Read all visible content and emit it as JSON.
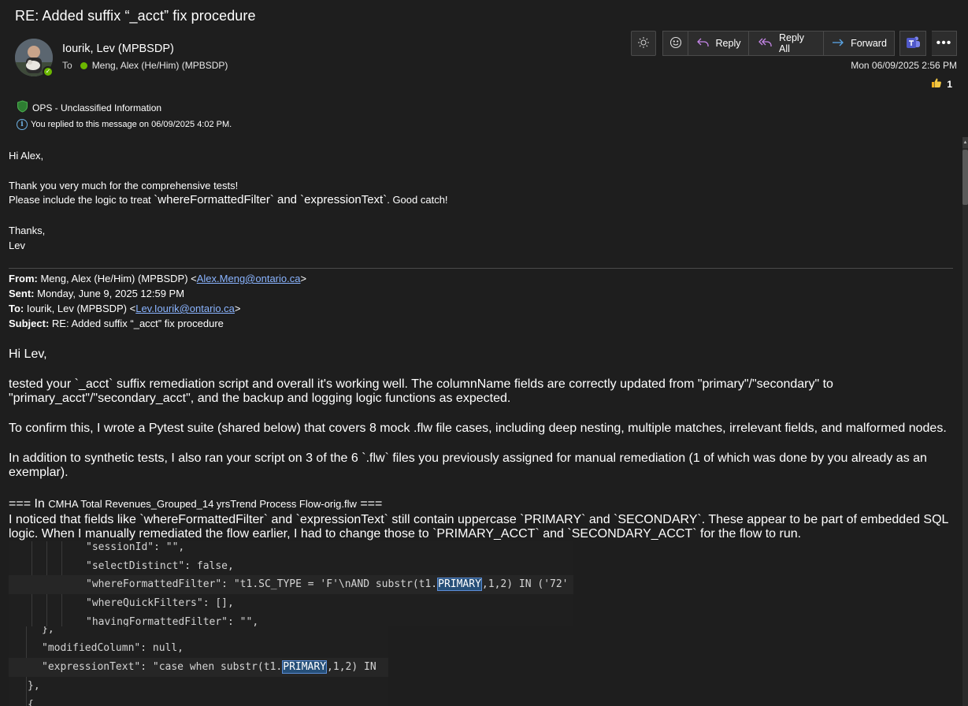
{
  "message": {
    "subject": "RE: Added suffix “_acct” fix procedure",
    "sender_name": "Iourik, Lev (MPBSDP)",
    "to_label": "To",
    "to_recipient": "Meng, Alex (He/Him) (MPBSDP)",
    "date": "Mon 06/09/2025 2:56 PM",
    "like_count": "1",
    "sensitivity_label": "OPS - Unclassified Information",
    "info_notice": "You replied to this message on 06/09/2025 4:02 PM."
  },
  "toolbar": {
    "reply_label": "Reply",
    "reply_all_label": "Reply All",
    "forward_label": "Forward"
  },
  "body": {
    "greeting": "Hi Alex,",
    "line1": "Thank you very much for the comprehensive tests!",
    "line2_prefix": "Please include the logic to treat ",
    "line2_code": "`whereFormattedFilter` and `expressionText`",
    "line2_suffix": ". Good catch!",
    "signoff": "Thanks,",
    "signature": "Lev"
  },
  "quoted_header": {
    "from_label": "From:",
    "from_name": " Meng, Alex (He/Him) (MPBSDP) <",
    "from_email": "Alex.Meng@ontario.ca",
    "from_close": ">",
    "sent_label": "Sent:",
    "sent_value": " Monday, June 9, 2025 12:59 PM",
    "to_label": "To:",
    "to_name": " Iourik, Lev (MPBSDP) <",
    "to_email": "Lev.Iourik@ontario.ca",
    "to_close": ">",
    "subject_label": "Subject:",
    "subject_value": " RE: Added suffix “_acct” fix procedure"
  },
  "quoted_body": {
    "greeting": "Hi Lev,",
    "para1": "tested your `_acct` suffix remediation script and overall it's working well. The columnName fields are correctly updated from \"primary\"/\"secondary\" to \"primary_acct\"/\"secondary_acct\", and the backup and logging logic functions as expected.",
    "para2": "To confirm this, I wrote a Pytest suite (shared below) that covers 8 mock .flw file cases, including deep nesting, multiple matches, irrelevant fields, and malformed nodes.",
    "para3": "In addition to synthetic tests, I also ran your script on 3 of the 6 `.flw` files you previously assigned for manual remediation (1 of which was done by you already as an exemplar).",
    "section_prefix": "=== In ",
    "section_file": "CMHA Total Revenues_Grouped_14 yrsTrend Process Flow-orig.flw",
    "section_suffix": " ===",
    "para4": "I noticed that fields like `whereFormattedFilter` and `expressionText` still contain uppercase `PRIMARY` and `SECONDARY`. These appear to be part of embedded SQL logic. When I manually remediated the flow earlier, I had to change those to `PRIMARY_ACCT` and `SECONDARY_ACCT` for the flow to run."
  },
  "code1": {
    "line1": "\"sessionId\": \"\",",
    "line2": "\"selectDistinct\": false,",
    "line3_pre": "\"whereFormattedFilter\": \"t1.SC_TYPE = 'F'\\nAND substr(t1.",
    "line3_sel": "PRIMARY",
    "line3_post": ",1,2) IN ('72'",
    "line4": "\"whereQuickFilters\": [],",
    "line5": "\"havingFormattedFilter\": \"\","
  },
  "code2": {
    "line0": "},",
    "line1": "\"modifiedColumn\": null,",
    "line2_pre": "\"expressionText\": \"case when substr(t1.",
    "line2_sel": "PRIMARY",
    "line2_post": ",1,2) IN",
    "line3": "},",
    "line4": "{"
  },
  "colors": {
    "background": "#1e1e1e",
    "accent_green": "#6bb700",
    "link_blue": "#8ab4ff",
    "selection": "#264f78"
  },
  "icons": [
    "sun-icon",
    "emoji-icon",
    "reply-icon",
    "reply-all-icon",
    "forward-icon",
    "teams-icon",
    "more-icon",
    "thumbs-up-icon",
    "shield-icon",
    "info-icon"
  ]
}
